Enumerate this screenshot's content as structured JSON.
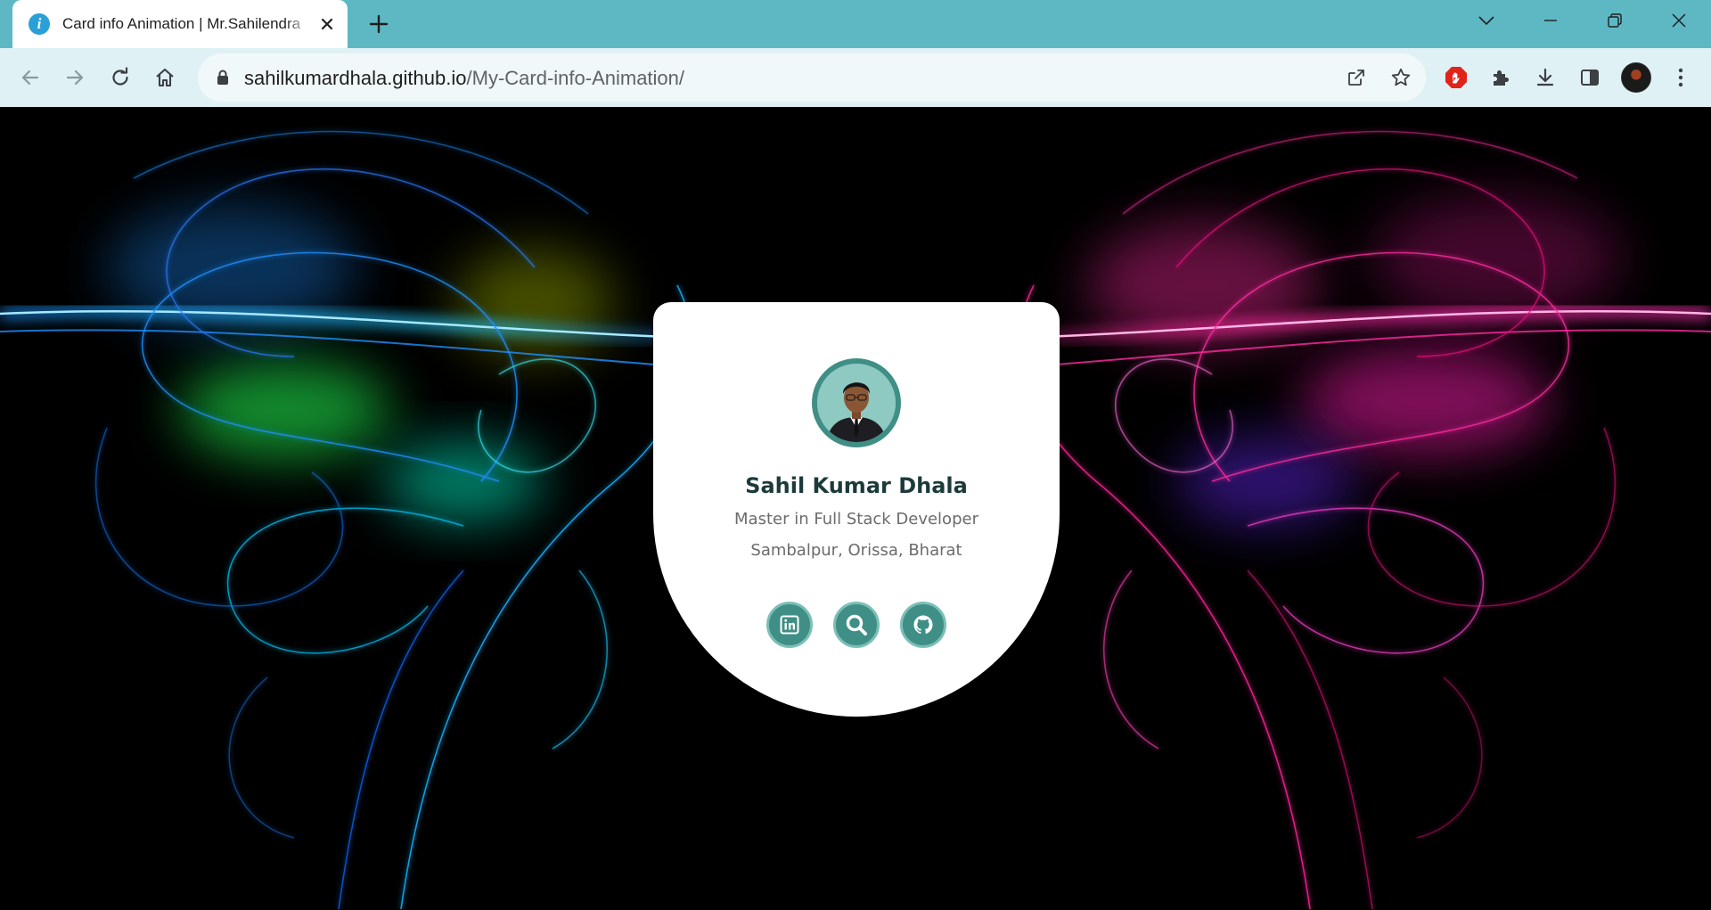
{
  "browser": {
    "tab": {
      "favicon_glyph": "i",
      "title": "Card info Animation | Mr.Sahilendra"
    },
    "address_bar": {
      "url_domain": "sahilkumardhala.github.io",
      "url_path": "/My-Card-info-Animation/"
    },
    "colors": {
      "tabstrip": "#5db8c4",
      "toolbar": "#dff1f4"
    },
    "icons": {
      "tab_strip": [
        "info-icon",
        "close-icon",
        "plus-icon",
        "chevron-down-icon",
        "minimize-icon",
        "restore-icon",
        "window-close-icon"
      ],
      "toolbar": [
        "back-arrow-icon",
        "forward-arrow-icon",
        "reload-icon",
        "home-icon",
        "lock-icon",
        "share-icon",
        "star-icon",
        "adblock-icon",
        "puzzle-icon",
        "download-icon",
        "side-panel-icon",
        "avatar",
        "kebab-menu-icon"
      ]
    }
  },
  "card": {
    "name": "Sahil Kumar Dhala",
    "role": "Master in Full Stack Developer",
    "location": "Sambalpur, Orissa, Bharat",
    "accent_color": "#3f8f86",
    "social_icons": [
      "linkedin-icon",
      "search-icon",
      "github-icon"
    ]
  }
}
